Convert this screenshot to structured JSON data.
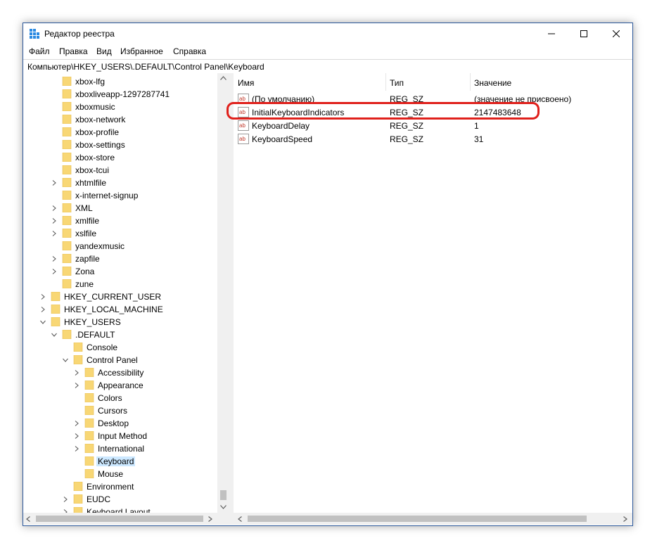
{
  "window": {
    "title": "Редактор реестра",
    "controls": {
      "minimize": "—",
      "maximize": "☐",
      "close": "✕"
    }
  },
  "menu": {
    "items": [
      {
        "label": "Файл"
      },
      {
        "label": "Правка"
      },
      {
        "label": "Вид"
      },
      {
        "label": "Избранное"
      },
      {
        "label": "Справка"
      }
    ]
  },
  "address": {
    "path": "Компьютер\\HKEY_USERS\\.DEFAULT\\Control Panel\\Keyboard"
  },
  "tree": {
    "nodes": [
      {
        "label": "xbox-lfg",
        "level": 3,
        "expander": "none"
      },
      {
        "label": "xboxliveapp-1297287741",
        "level": 3,
        "expander": "none"
      },
      {
        "label": "xboxmusic",
        "level": 3,
        "expander": "none"
      },
      {
        "label": "xbox-network",
        "level": 3,
        "expander": "none"
      },
      {
        "label": "xbox-profile",
        "level": 3,
        "expander": "none"
      },
      {
        "label": "xbox-settings",
        "level": 3,
        "expander": "none"
      },
      {
        "label": "xbox-store",
        "level": 3,
        "expander": "none"
      },
      {
        "label": "xbox-tcui",
        "level": 3,
        "expander": "none"
      },
      {
        "label": "xhtmlfile",
        "level": 3,
        "expander": "collapsed"
      },
      {
        "label": "x-internet-signup",
        "level": 3,
        "expander": "none"
      },
      {
        "label": "XML",
        "level": 3,
        "expander": "collapsed"
      },
      {
        "label": "xmlfile",
        "level": 3,
        "expander": "collapsed"
      },
      {
        "label": "xslfile",
        "level": 3,
        "expander": "collapsed"
      },
      {
        "label": "yandexmusic",
        "level": 3,
        "expander": "none"
      },
      {
        "label": "zapfile",
        "level": 3,
        "expander": "collapsed"
      },
      {
        "label": "Zona",
        "level": 3,
        "expander": "collapsed"
      },
      {
        "label": "zune",
        "level": 3,
        "expander": "none"
      },
      {
        "label": "HKEY_CURRENT_USER",
        "level": 2,
        "expander": "collapsed"
      },
      {
        "label": "HKEY_LOCAL_MACHINE",
        "level": 2,
        "expander": "collapsed"
      },
      {
        "label": "HKEY_USERS",
        "level": 2,
        "expander": "expanded"
      },
      {
        "label": ".DEFAULT",
        "level": 3,
        "expander": "expanded"
      },
      {
        "label": "Console",
        "level": 4,
        "expander": "none"
      },
      {
        "label": "Control Panel",
        "level": 4,
        "expander": "expanded"
      },
      {
        "label": "Accessibility",
        "level": 5,
        "expander": "collapsed"
      },
      {
        "label": "Appearance",
        "level": 5,
        "expander": "collapsed"
      },
      {
        "label": "Colors",
        "level": 5,
        "expander": "none"
      },
      {
        "label": "Cursors",
        "level": 5,
        "expander": "none"
      },
      {
        "label": "Desktop",
        "level": 5,
        "expander": "collapsed"
      },
      {
        "label": "Input Method",
        "level": 5,
        "expander": "collapsed"
      },
      {
        "label": "International",
        "level": 5,
        "expander": "collapsed"
      },
      {
        "label": "Keyboard",
        "level": 5,
        "expander": "none",
        "selected": true
      },
      {
        "label": "Mouse",
        "level": 5,
        "expander": "none"
      },
      {
        "label": "Environment",
        "level": 4,
        "expander": "none"
      },
      {
        "label": "EUDC",
        "level": 4,
        "expander": "collapsed"
      },
      {
        "label": "Keyboard Layout",
        "level": 4,
        "expander": "collapsed"
      }
    ]
  },
  "list": {
    "columns": {
      "name": "Имя",
      "type": "Тип",
      "value": "Значение"
    },
    "rows": [
      {
        "name": "(По умолчанию)",
        "type": "REG_SZ",
        "value": "(значение не присвоено)",
        "icon": "string-value-icon"
      },
      {
        "name": "InitialKeyboardIndicators",
        "type": "REG_SZ",
        "value": "2147483648",
        "icon": "string-value-icon",
        "highlighted": true
      },
      {
        "name": "KeyboardDelay",
        "type": "REG_SZ",
        "value": "1",
        "icon": "string-value-icon"
      },
      {
        "name": "KeyboardSpeed",
        "type": "REG_SZ",
        "value": "31",
        "icon": "string-value-icon"
      }
    ]
  },
  "colors": {
    "highlight_ring": "#e0201b",
    "selection": "#cce8ff",
    "folder": "#f8d775"
  }
}
